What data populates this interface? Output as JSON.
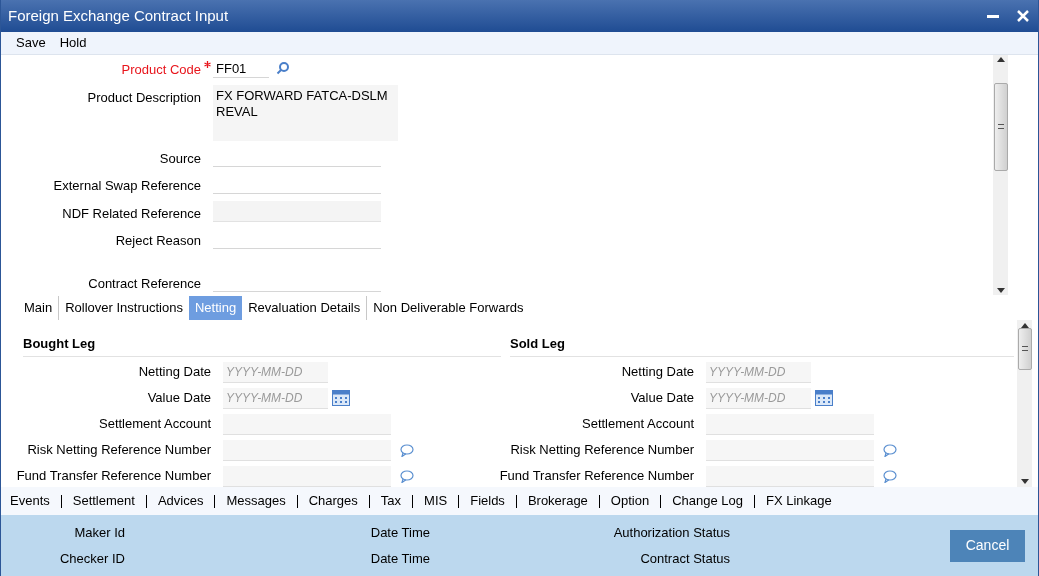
{
  "window": {
    "title": "Foreign Exchange Contract Input",
    "controls": [
      {
        "kind": "minimize"
      },
      {
        "kind": "close"
      }
    ]
  },
  "toolbar": [
    "Save",
    "Hold"
  ],
  "header_fields": [
    {
      "label": "Product Code",
      "required": true,
      "kind": "lookup",
      "value": "FF01"
    },
    {
      "label": "Product Description",
      "required": false,
      "kind": "textarea",
      "value": "FX FORWARD FATCA-DSLM REVAL"
    },
    {
      "label": "Source",
      "required": false,
      "kind": "text"
    },
    {
      "label": "External Swap Reference",
      "required": false,
      "kind": "text"
    },
    {
      "label": "NDF Related Reference",
      "required": false,
      "kind": "readonly"
    },
    {
      "label": "Reject Reason",
      "required": false,
      "kind": "text"
    },
    {
      "label": "Contract Reference",
      "required": false,
      "kind": "text"
    }
  ],
  "tabs": [
    {
      "label": "Main",
      "selected": false
    },
    {
      "label": "Rollover Instructions",
      "selected": false
    },
    {
      "label": "Netting",
      "selected": true
    },
    {
      "label": "Revaluation Details",
      "selected": false
    },
    {
      "label": "Non Deliverable Forwards",
      "selected": false
    }
  ],
  "legs": [
    {
      "title": "Bought Leg",
      "fields": [
        {
          "label": "Netting Date",
          "kind": "date",
          "placeholder": "YYYY-MM-DD",
          "calendar": false
        },
        {
          "label": "Value Date",
          "kind": "date",
          "placeholder": "YYYY-MM-DD",
          "calendar": true
        },
        {
          "label": "Settlement Account",
          "kind": "text"
        },
        {
          "label": "Risk Netting Reference Number",
          "kind": "lookup"
        },
        {
          "label": "Fund Transfer Reference Number",
          "kind": "lookup"
        }
      ]
    },
    {
      "title": "Sold Leg",
      "fields": [
        {
          "label": "Netting Date",
          "kind": "date",
          "placeholder": "YYYY-MM-DD",
          "calendar": false
        },
        {
          "label": "Value Date",
          "kind": "date",
          "placeholder": "YYYY-MM-DD",
          "calendar": true
        },
        {
          "label": "Settlement Account",
          "kind": "text"
        },
        {
          "label": "Risk Netting Reference Number",
          "kind": "lookup"
        },
        {
          "label": "Fund Transfer Reference Number",
          "kind": "lookup"
        }
      ]
    }
  ],
  "footer_links": [
    "Events",
    "Settlement",
    "Advices",
    "Messages",
    "Charges",
    "Tax",
    "MIS",
    "Fields",
    "Brokerage",
    "Option",
    "Change Log",
    "FX Linkage"
  ],
  "audit": [
    {
      "label": "Maker Id"
    },
    {
      "label": "Date Time"
    },
    {
      "label": "Authorization Status"
    },
    {
      "label": "Checker ID"
    },
    {
      "label": "Date Time"
    },
    {
      "label": "Contract Status"
    }
  ],
  "cancel_button": "Cancel"
}
